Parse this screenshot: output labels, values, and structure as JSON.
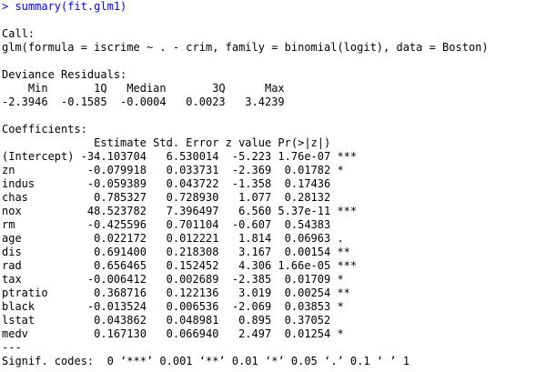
{
  "console": {
    "command": "> summary(fit.glm1)",
    "call_header": "Call:",
    "call_text": "glm(formula = iscrime ~ . - crim, family = binomial(logit), data = Boston)",
    "deviance_header": "Deviance Residuals:",
    "deviance_labels": "    Min       1Q   Median       3Q      Max  ",
    "deviance_values": "-2.3946  -0.1585  -0.0004   0.0023   3.4239  ",
    "coefficients_header": "Coefficients:",
    "coef_columns": "              Estimate Std. Error z value Pr(>|z|)    ",
    "coef_rows": [
      "(Intercept) -34.103704   6.530014  -5.223 1.76e-07 ***",
      "zn           -0.079918   0.033731  -2.369  0.01782 *  ",
      "indus        -0.059389   0.043722  -1.358  0.17436    ",
      "chas          0.785327   0.728930   1.077  0.28132    ",
      "nox          48.523782   7.396497   6.560 5.37e-11 ***",
      "rm           -0.425596   0.701104  -0.607  0.54383    ",
      "age           0.022172   0.012221   1.814  0.06963 .  ",
      "dis           0.691400   0.218308   3.167  0.00154 ** ",
      "rad           0.656465   0.152452   4.306 1.66e-05 ***",
      "tax          -0.006412   0.002689  -2.385  0.01709 *  ",
      "ptratio       0.368716   0.122136   3.019  0.00254 ** ",
      "black        -0.013524   0.006536  -2.069  0.03853 *  ",
      "lstat         0.043862   0.048981   0.895  0.37052    ",
      "medv          0.167130   0.066940   2.497  0.01254 *  "
    ],
    "separator": "---",
    "signif_codes": "Signif. codes:  0 ‘***’ 0.001 ‘**’ 0.01 ‘*’ 0.05 ‘.’ 0.1 ‘ ’ 1"
  },
  "colors": {
    "command": "#0000ff",
    "output": "#000000",
    "background": "#ffffff"
  }
}
